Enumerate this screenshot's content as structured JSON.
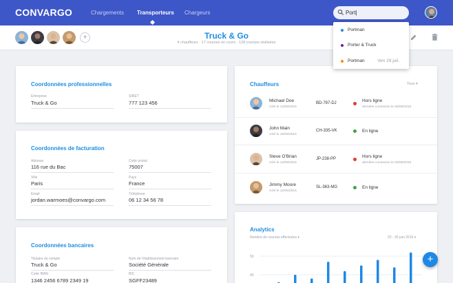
{
  "app": {
    "logo": "CONVARGO"
  },
  "nav": [
    {
      "label": "Chargements"
    },
    {
      "label": "Transporteurs"
    },
    {
      "label": "Chargeurs"
    }
  ],
  "search": {
    "value": "Port|"
  },
  "suggestions": [
    {
      "label": "Portman",
      "date": "",
      "color": "#1e88e5"
    },
    {
      "label": "Porter & Truck",
      "date": "",
      "color": "#6a1b9a"
    },
    {
      "label": "Portman",
      "date": "Ven 29 juil.",
      "color": "#fb8c00"
    }
  ],
  "company": {
    "name": "Truck & Go",
    "subtitle": "4 chauffeurs  ·  17 courses en cours  ·  128 courses réalisées"
  },
  "pro": {
    "title": "Coordonnées professionnelles",
    "fields": [
      {
        "label": "Entreprise",
        "value": "Truck & Go"
      },
      {
        "label": "SIRET",
        "value": "777 123 456"
      }
    ]
  },
  "billing": {
    "title": "Coordonnées de facturation",
    "fields": [
      {
        "label": "Adresse",
        "value": "116 rue du Bac"
      },
      {
        "label": "Code postal",
        "value": "75007"
      },
      {
        "label": "Ville",
        "value": "Paris"
      },
      {
        "label": "Pays",
        "value": "France"
      },
      {
        "label": "Email",
        "value": "jordan.warmoes@convargo.com"
      },
      {
        "label": "Téléphone",
        "value": "06 12 34 56 78"
      }
    ]
  },
  "bank": {
    "title": "Coordonnées bancaires",
    "fields": [
      {
        "label": "Titulaire du compte",
        "value": "Truck & Go"
      },
      {
        "label": "Nom de l'établissement bancaire",
        "value": "Société Générale"
      },
      {
        "label": "Code IBAN",
        "value": "1346 2456 6789 2349 19"
      },
      {
        "label": "BIC",
        "value": "SGFF23489"
      }
    ]
  },
  "drivers": {
    "title": "Chauffeurs",
    "filter": "Tous",
    "rows": [
      {
        "name": "Michael Doe",
        "since": "créé le 12/05/2016",
        "plate": "BD-787-DJ",
        "status": "Hors ligne",
        "last": "dernière connexion le 26/06/2016",
        "color": "#e53935"
      },
      {
        "name": "John Main",
        "since": "créé le 19/05/2016",
        "plate": "CH-335-VK",
        "status": "En ligne",
        "last": "",
        "color": "#43a047"
      },
      {
        "name": "Steve O'Brian",
        "since": "créé le 12/05/2016",
        "plate": "JP-238-PP",
        "status": "Hors ligne",
        "last": "dernière connexion le 25/06/2016",
        "color": "#e53935"
      },
      {
        "name": "Jimmy Moore",
        "since": "créé le 12/05/2016",
        "plate": "SL-363-MG",
        "status": "En ligne",
        "last": "",
        "color": "#43a047"
      }
    ]
  },
  "analytics": {
    "title": "Analytics",
    "metric": "Nombre de courses effectuées",
    "range": "20 - 26 juin 2016"
  },
  "chart_data": {
    "type": "bar",
    "ylabels": [
      "50",
      "40"
    ],
    "values": [
      36,
      40,
      38,
      47,
      42,
      45,
      48,
      44,
      52
    ],
    "color": "#1e88e5"
  },
  "fab": {
    "label": "+"
  }
}
